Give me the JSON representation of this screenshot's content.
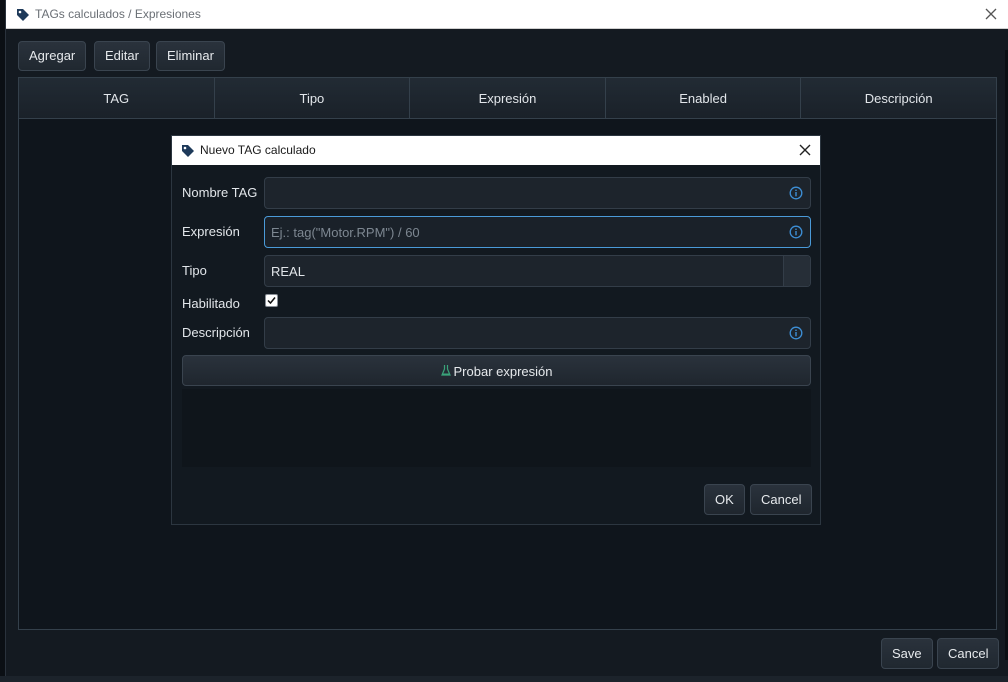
{
  "main_window": {
    "title": "TAGs calculados / Expresiones",
    "toolbar": {
      "add_label": "Agregar",
      "edit_label": "Editar",
      "delete_label": "Eliminar"
    },
    "table": {
      "columns": [
        "TAG",
        "Tipo",
        "Expresión",
        "Enabled",
        "Descripción"
      ]
    },
    "save_label": "Save",
    "cancel_label": "Cancel"
  },
  "dialog": {
    "title": "Nuevo TAG calculado",
    "fields": {
      "name_label": "Nombre TAG",
      "name_value": "",
      "expression_label": "Expresión",
      "expression_placeholder": "Ej.: tag(\"Motor.RPM\") / 60",
      "type_label": "Tipo",
      "type_value": "REAL",
      "enabled_label": "Habilitado",
      "enabled_checked": true,
      "description_label": "Descripción",
      "description_value": ""
    },
    "test_button_label": "Probar expresión",
    "ok_label": "OK",
    "cancel_label": "Cancel"
  },
  "colors": {
    "accent_focus": "#4a9ad8",
    "info_icon": "#3d8fd6",
    "test_icon": "#3aa37a"
  },
  "icons": {
    "window_icon": "tag-icon",
    "close": "close-icon",
    "info": "info-icon",
    "test": "flask-icon",
    "checkbox": "check-icon"
  }
}
